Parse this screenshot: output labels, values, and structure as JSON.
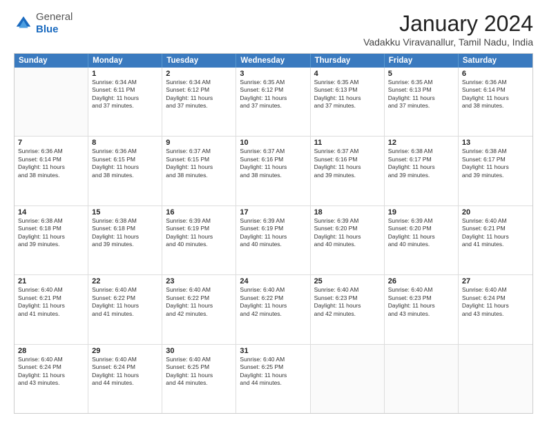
{
  "logo": {
    "general": "General",
    "blue": "Blue"
  },
  "header": {
    "title": "January 2024",
    "subtitle": "Vadakku Viravanallur, Tamil Nadu, India"
  },
  "days": [
    "Sunday",
    "Monday",
    "Tuesday",
    "Wednesday",
    "Thursday",
    "Friday",
    "Saturday"
  ],
  "weeks": [
    [
      {
        "day": "",
        "lines": []
      },
      {
        "day": "1",
        "lines": [
          "Sunrise: 6:34 AM",
          "Sunset: 6:11 PM",
          "Daylight: 11 hours",
          "and 37 minutes."
        ]
      },
      {
        "day": "2",
        "lines": [
          "Sunrise: 6:34 AM",
          "Sunset: 6:12 PM",
          "Daylight: 11 hours",
          "and 37 minutes."
        ]
      },
      {
        "day": "3",
        "lines": [
          "Sunrise: 6:35 AM",
          "Sunset: 6:12 PM",
          "Daylight: 11 hours",
          "and 37 minutes."
        ]
      },
      {
        "day": "4",
        "lines": [
          "Sunrise: 6:35 AM",
          "Sunset: 6:13 PM",
          "Daylight: 11 hours",
          "and 37 minutes."
        ]
      },
      {
        "day": "5",
        "lines": [
          "Sunrise: 6:35 AM",
          "Sunset: 6:13 PM",
          "Daylight: 11 hours",
          "and 37 minutes."
        ]
      },
      {
        "day": "6",
        "lines": [
          "Sunrise: 6:36 AM",
          "Sunset: 6:14 PM",
          "Daylight: 11 hours",
          "and 38 minutes."
        ]
      }
    ],
    [
      {
        "day": "7",
        "lines": [
          "Sunrise: 6:36 AM",
          "Sunset: 6:14 PM",
          "Daylight: 11 hours",
          "and 38 minutes."
        ]
      },
      {
        "day": "8",
        "lines": [
          "Sunrise: 6:36 AM",
          "Sunset: 6:15 PM",
          "Daylight: 11 hours",
          "and 38 minutes."
        ]
      },
      {
        "day": "9",
        "lines": [
          "Sunrise: 6:37 AM",
          "Sunset: 6:15 PM",
          "Daylight: 11 hours",
          "and 38 minutes."
        ]
      },
      {
        "day": "10",
        "lines": [
          "Sunrise: 6:37 AM",
          "Sunset: 6:16 PM",
          "Daylight: 11 hours",
          "and 38 minutes."
        ]
      },
      {
        "day": "11",
        "lines": [
          "Sunrise: 6:37 AM",
          "Sunset: 6:16 PM",
          "Daylight: 11 hours",
          "and 39 minutes."
        ]
      },
      {
        "day": "12",
        "lines": [
          "Sunrise: 6:38 AM",
          "Sunset: 6:17 PM",
          "Daylight: 11 hours",
          "and 39 minutes."
        ]
      },
      {
        "day": "13",
        "lines": [
          "Sunrise: 6:38 AM",
          "Sunset: 6:17 PM",
          "Daylight: 11 hours",
          "and 39 minutes."
        ]
      }
    ],
    [
      {
        "day": "14",
        "lines": [
          "Sunrise: 6:38 AM",
          "Sunset: 6:18 PM",
          "Daylight: 11 hours",
          "and 39 minutes."
        ]
      },
      {
        "day": "15",
        "lines": [
          "Sunrise: 6:38 AM",
          "Sunset: 6:18 PM",
          "Daylight: 11 hours",
          "and 39 minutes."
        ]
      },
      {
        "day": "16",
        "lines": [
          "Sunrise: 6:39 AM",
          "Sunset: 6:19 PM",
          "Daylight: 11 hours",
          "and 40 minutes."
        ]
      },
      {
        "day": "17",
        "lines": [
          "Sunrise: 6:39 AM",
          "Sunset: 6:19 PM",
          "Daylight: 11 hours",
          "and 40 minutes."
        ]
      },
      {
        "day": "18",
        "lines": [
          "Sunrise: 6:39 AM",
          "Sunset: 6:20 PM",
          "Daylight: 11 hours",
          "and 40 minutes."
        ]
      },
      {
        "day": "19",
        "lines": [
          "Sunrise: 6:39 AM",
          "Sunset: 6:20 PM",
          "Daylight: 11 hours",
          "and 40 minutes."
        ]
      },
      {
        "day": "20",
        "lines": [
          "Sunrise: 6:40 AM",
          "Sunset: 6:21 PM",
          "Daylight: 11 hours",
          "and 41 minutes."
        ]
      }
    ],
    [
      {
        "day": "21",
        "lines": [
          "Sunrise: 6:40 AM",
          "Sunset: 6:21 PM",
          "Daylight: 11 hours",
          "and 41 minutes."
        ]
      },
      {
        "day": "22",
        "lines": [
          "Sunrise: 6:40 AM",
          "Sunset: 6:22 PM",
          "Daylight: 11 hours",
          "and 41 minutes."
        ]
      },
      {
        "day": "23",
        "lines": [
          "Sunrise: 6:40 AM",
          "Sunset: 6:22 PM",
          "Daylight: 11 hours",
          "and 42 minutes."
        ]
      },
      {
        "day": "24",
        "lines": [
          "Sunrise: 6:40 AM",
          "Sunset: 6:22 PM",
          "Daylight: 11 hours",
          "and 42 minutes."
        ]
      },
      {
        "day": "25",
        "lines": [
          "Sunrise: 6:40 AM",
          "Sunset: 6:23 PM",
          "Daylight: 11 hours",
          "and 42 minutes."
        ]
      },
      {
        "day": "26",
        "lines": [
          "Sunrise: 6:40 AM",
          "Sunset: 6:23 PM",
          "Daylight: 11 hours",
          "and 43 minutes."
        ]
      },
      {
        "day": "27",
        "lines": [
          "Sunrise: 6:40 AM",
          "Sunset: 6:24 PM",
          "Daylight: 11 hours",
          "and 43 minutes."
        ]
      }
    ],
    [
      {
        "day": "28",
        "lines": [
          "Sunrise: 6:40 AM",
          "Sunset: 6:24 PM",
          "Daylight: 11 hours",
          "and 43 minutes."
        ]
      },
      {
        "day": "29",
        "lines": [
          "Sunrise: 6:40 AM",
          "Sunset: 6:24 PM",
          "Daylight: 11 hours",
          "and 44 minutes."
        ]
      },
      {
        "day": "30",
        "lines": [
          "Sunrise: 6:40 AM",
          "Sunset: 6:25 PM",
          "Daylight: 11 hours",
          "and 44 minutes."
        ]
      },
      {
        "day": "31",
        "lines": [
          "Sunrise: 6:40 AM",
          "Sunset: 6:25 PM",
          "Daylight: 11 hours",
          "and 44 minutes."
        ]
      },
      {
        "day": "",
        "lines": []
      },
      {
        "day": "",
        "lines": []
      },
      {
        "day": "",
        "lines": []
      }
    ]
  ]
}
